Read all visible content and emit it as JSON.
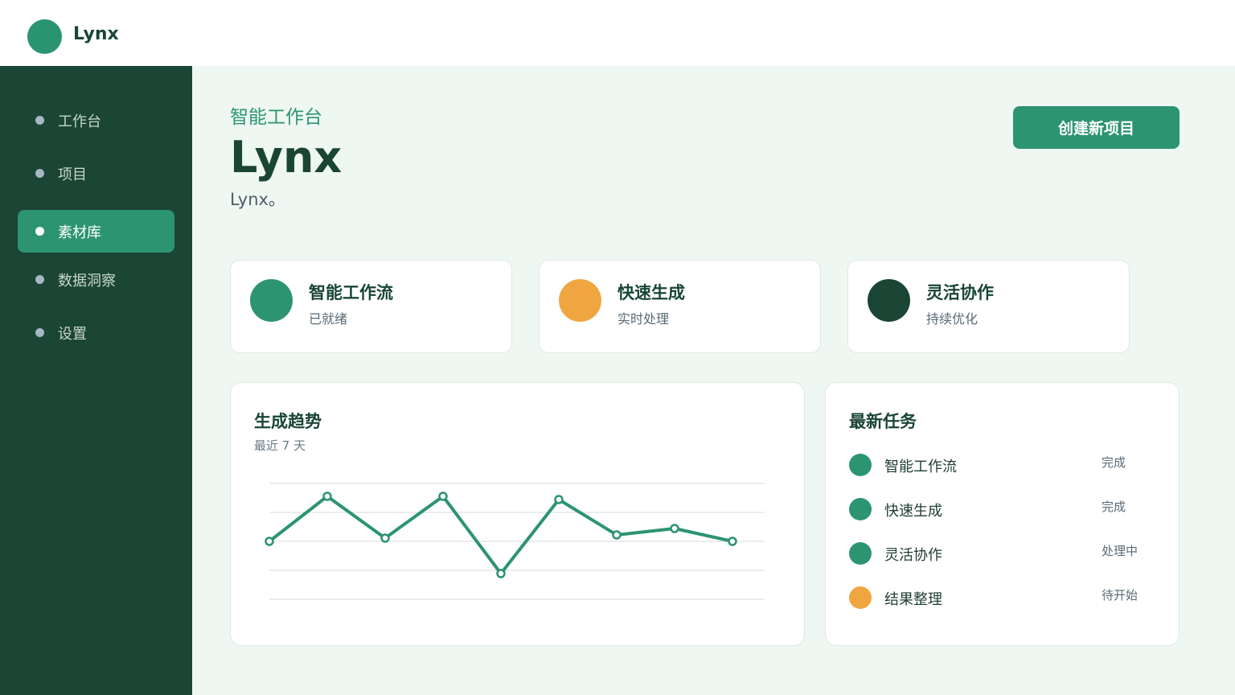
{
  "app": {
    "name": "Lynx"
  },
  "sidebar": {
    "items": [
      {
        "label": "工作台",
        "active": false
      },
      {
        "label": "项目",
        "active": false
      },
      {
        "label": "素材库",
        "active": true
      },
      {
        "label": "数据洞察",
        "active": false
      },
      {
        "label": "设置",
        "active": false
      }
    ]
  },
  "header": {
    "eyebrow": "智能工作台",
    "title": "Lynx",
    "subtitle": "Lynx。",
    "create_button": "创建新项目"
  },
  "stats": [
    {
      "title": "智能工作流",
      "sub": "已就绪",
      "color": "#2c9470"
    },
    {
      "title": "快速生成",
      "sub": "实时处理",
      "color": "#f0a640"
    },
    {
      "title": "灵活协作",
      "sub": "持续优化",
      "color": "#1b4535"
    }
  ],
  "trend": {
    "title": "生成趋势",
    "subtitle": "最近 7 天"
  },
  "chart_data": {
    "type": "line",
    "title": "生成趋势",
    "subtitle": "最近 7 天",
    "x": [
      1,
      2,
      3,
      4,
      5,
      6,
      7,
      8,
      9
    ],
    "values": [
      52,
      66,
      53,
      66,
      42,
      65,
      54,
      56,
      52
    ],
    "ylim": [
      34,
      70
    ],
    "grid": true,
    "legend": "none",
    "color": "#2c9470"
  },
  "tasks": {
    "title": "最新任务",
    "items": [
      {
        "name": "智能工作流",
        "status": "完成",
        "color": "#2c9470"
      },
      {
        "name": "快速生成",
        "status": "完成",
        "color": "#2c9470"
      },
      {
        "name": "灵活协作",
        "status": "处理中",
        "color": "#2c9470"
      },
      {
        "name": "结果整理",
        "status": "待开始",
        "color": "#f0a640"
      }
    ]
  },
  "colors": {
    "accent": "#2c9470",
    "sidebar": "#1b4535",
    "warning": "#f0a640"
  }
}
